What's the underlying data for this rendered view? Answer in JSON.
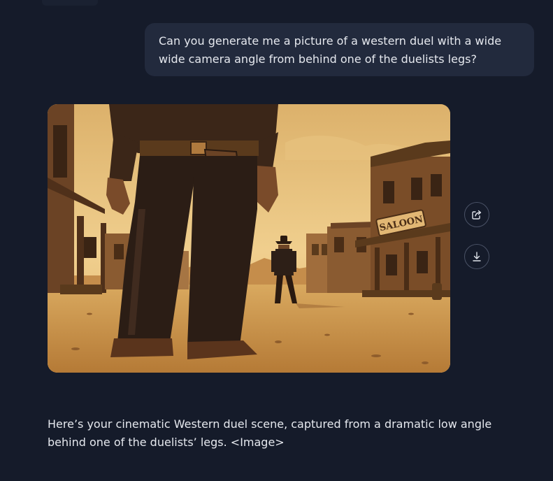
{
  "conversation": {
    "user_message": "Can you generate me a picture of a western duel with a wide wide camera angle from behind one of the duelists legs?",
    "assistant_message": "Here’s your cinematic Western duel scene, captured from a dramatic low angle behind one of the duelists’ legs. <Image>"
  },
  "image": {
    "sign_text": "SALOON"
  },
  "actions": {
    "share_icon": "share-icon",
    "download_icon": "download-icon"
  },
  "colors": {
    "background": "#151b2a",
    "user_bubble": "#222a3d",
    "text": "#e5e8ee",
    "button_border": "#4a5266"
  }
}
